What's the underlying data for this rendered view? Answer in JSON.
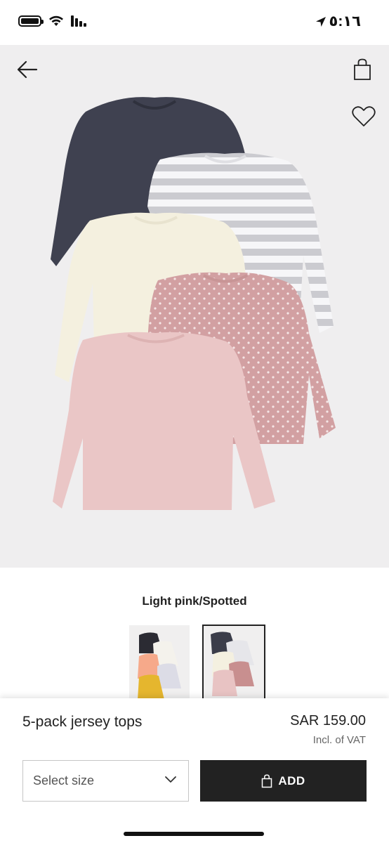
{
  "status_bar": {
    "time": "٥:١٦",
    "icons": [
      "battery-icon",
      "wifi-icon",
      "signal-icon",
      "location-arrow-icon"
    ]
  },
  "nav": {
    "icons": [
      "back-arrow-icon",
      "shopping-bag-icon",
      "heart-icon"
    ]
  },
  "product": {
    "color_name": "Light pink/Spotted",
    "name": "5-pack jersey tops",
    "price": "SAR 159.00",
    "vat_note": "Incl. of VAT"
  },
  "swatches": [
    {
      "colors": [
        "#2b2b33",
        "#f4f2ec",
        "#f6a98a",
        "#dcdce6",
        "#e5b62e"
      ],
      "selected": false
    },
    {
      "colors": [
        "#3b3d4a",
        "#e6e6ea",
        "#f4f0e0",
        "#c88f8f",
        "#e8c3c3"
      ],
      "selected": true
    }
  ],
  "size_select": {
    "label": "Select size"
  },
  "add_button": {
    "label": "ADD"
  },
  "colors": {
    "accent": "#222222",
    "background_image": "#efeeef",
    "navy": "#3f4150",
    "stripe_white": "#f5f5f7",
    "stripe_gray": "#c9c9cd",
    "cream": "#f4f0df",
    "dusty_pink": "#d6a3a4",
    "light_pink": "#eac6c6"
  }
}
